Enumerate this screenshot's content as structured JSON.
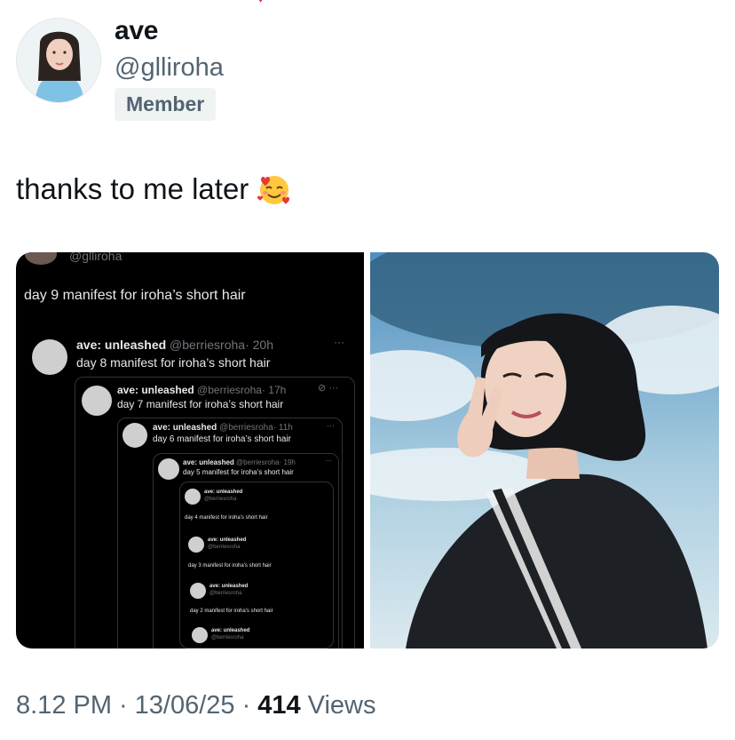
{
  "author": {
    "display_name": "ave",
    "handle": "@glliroha",
    "badge": "Member"
  },
  "tweet": {
    "text": "thanks to me later",
    "emoji": "smiling-face-with-hearts-icon"
  },
  "screenshot": {
    "cut_handle": "@glliroha",
    "main_text": "day 9 manifest for iroha’s short hair",
    "quotes": [
      {
        "name": "ave: unleashed",
        "handle": "@berriesroha",
        "time": "· 20h",
        "text": "day 8 manifest for iroha’s short hair"
      },
      {
        "name": "ave: unleashed",
        "handle": "@berriesroha",
        "time": "· 17h",
        "text": "day 7 manifest for iroha’s short hair"
      },
      {
        "name": "ave: unleashed",
        "handle": "@berriesroha",
        "time": "· 11h",
        "text": "day 6 manifest for iroha’s short hair"
      },
      {
        "name": "ave: unleashed",
        "handle": "@berriesroha",
        "time": "· 19h",
        "text": "day 5 manifest for iroha’s short hair"
      },
      {
        "name": "ave: unleashed",
        "handle": "@berriesroha",
        "time": "",
        "text": "day 4 manifest for iroha’s short hair"
      },
      {
        "name": "ave: unleashed",
        "handle": "@berriesroha",
        "time": "",
        "text": "day 3 manifest for iroha’s short hair"
      },
      {
        "name": "ave: unleashed",
        "handle": "@berriesroha",
        "time": "",
        "text": "day 2 manifest for iroha’s short hair"
      },
      {
        "name": "ave: unleashed",
        "handle": "@berriesroha",
        "time": "",
        "text": ""
      }
    ]
  },
  "footer": {
    "time": "8.12 PM",
    "sep1": "·",
    "date": "13/06/25",
    "sep2": "·",
    "views_count": "414",
    "views_label": "Views"
  },
  "colors": {
    "text": "#0f1419",
    "muted": "#536471",
    "badge_bg": "#eff3f4",
    "dark_bg": "#000000"
  }
}
